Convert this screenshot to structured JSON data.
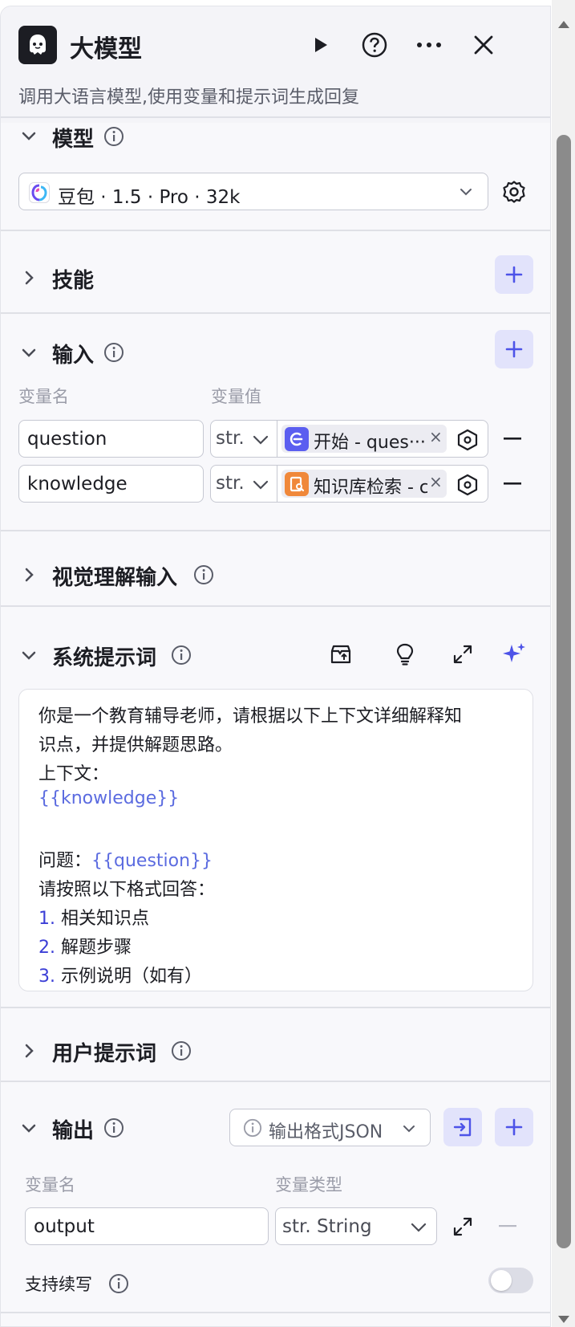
{
  "header": {
    "title": "大模型",
    "subtitle": "调用大语言模型,使用变量和提示词生成回复",
    "logo_icon": "bot-face-icon"
  },
  "model": {
    "section_title": "模型",
    "selected": "豆包 · 1.5 · Pro · 32k"
  },
  "skills": {
    "section_title": "技能"
  },
  "input": {
    "section_title": "输入",
    "col_name": "变量名",
    "col_value": "变量值",
    "rows": [
      {
        "name": "question",
        "type": "str.",
        "ref_label": "开始 - ques···",
        "ref_color": "#5b5ef0"
      },
      {
        "name": "knowledge",
        "type": "str.",
        "ref_label": "知识库检索 - c",
        "ref_color": "#f0883a"
      }
    ]
  },
  "visual_input": {
    "section_title": "视觉理解输入"
  },
  "system_prompt": {
    "section_title": "系统提示词",
    "lines": [
      {
        "text": "你是一个教育辅导老师，请根据以下上下文详细解释知"
      },
      {
        "text": "识点，并提供解题思路。"
      },
      {
        "text": "上下文："
      },
      {
        "var": "{{knowledge}}"
      },
      {
        "text": ""
      },
      {
        "text": "问题：",
        "var": "{{question}}"
      },
      {
        "text": "请按照以下格式回答："
      },
      {
        "num": "1.",
        "text": "相关知识点"
      },
      {
        "num": "2.",
        "text": "解题步骤"
      },
      {
        "num": "3.",
        "text": "示例说明（如有）"
      }
    ]
  },
  "user_prompt": {
    "section_title": "用户提示词"
  },
  "output": {
    "section_title": "输出",
    "format_label": "输出格式JSON",
    "col_name": "变量名",
    "col_type": "变量类型",
    "row": {
      "name": "output",
      "type": "str. String"
    },
    "continue_label": "支持续写",
    "continue_enabled": false
  },
  "colors": {
    "accent": "#4d53e8",
    "accent_bg": "#e2e3fb"
  }
}
